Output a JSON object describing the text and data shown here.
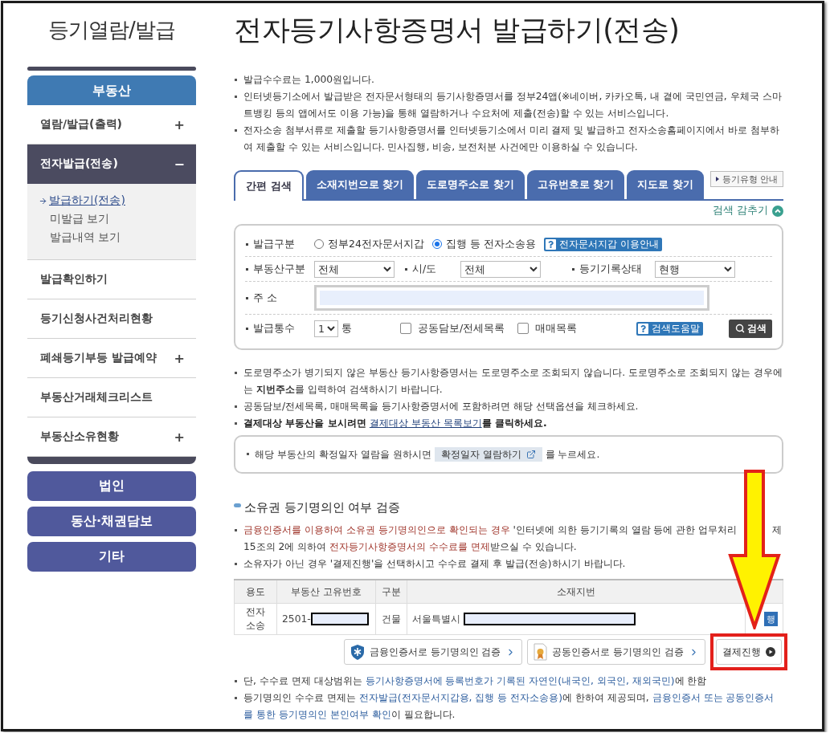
{
  "section_title": "등기열람/발급",
  "page_title": "전자등기사항증명서 발급하기(전송)",
  "sidebar": {
    "category": "부동산",
    "items": [
      {
        "label": "열람/발급(출력)",
        "toggle": "+",
        "selected": false
      },
      {
        "label": "전자발급(전송)",
        "toggle": "−",
        "selected": true,
        "children": [
          {
            "label": "발급하기(전송)",
            "selected": true
          },
          {
            "label": "미발급 보기",
            "selected": false
          },
          {
            "label": "발급내역 보기",
            "selected": false
          }
        ]
      },
      {
        "label": "발급확인하기",
        "selected": false
      },
      {
        "label": "등기신청사건처리현황",
        "selected": false
      },
      {
        "label": "폐쇄등기부등 발급예약",
        "toggle": "+",
        "selected": false
      },
      {
        "label": "부동산거래체크리스트",
        "selected": false
      },
      {
        "label": "부동산소유현황",
        "toggle": "+",
        "selected": false
      }
    ],
    "other_categories": [
      "법인",
      "동산·채권담보",
      "기타"
    ]
  },
  "intro_notes": [
    "발급수수료는 1,000원입니다.",
    "인터넷등기소에서 발급받은 전자문서형태의 등기사항증명서를 정부24앱(※네이버, 카카오톡, 내 곁에 국민연금, 우체국 스마트뱅킹 등의 앱에서도 이용 가능)을 통해 열람하거나 수요처에 제출(전송)할 수 있는 서비스입니다.",
    "전자소송 첨부서류로 제출할 등기사항증명서를 인터넷등기소에서 미리 결제 및 발급하고 전자소송홈페이지에서 바로 첨부하여 제출할 수 있는 서비스입니다. 민사집행, 비송, 보전처분 사건에만 이용하실 수 있습니다."
  ],
  "tabs": [
    {
      "label": "간편 검색",
      "selected": true
    },
    {
      "label": "소재지번으로 찾기",
      "selected": false
    },
    {
      "label": "도로명주소로 찾기",
      "selected": false
    },
    {
      "label": "고유번호로 찾기",
      "selected": false
    },
    {
      "label": "지도로 찾기",
      "selected": false
    }
  ],
  "guide_button": "등기유형 안내",
  "hide_search": "검색 감추기",
  "form": {
    "issue_type": {
      "label": "발급구분",
      "options": [
        {
          "label": "정부24전자문서지갑",
          "selected": false
        },
        {
          "label": "집행 등 전자소송용",
          "selected": true
        }
      ],
      "help": "전자문서지갑 이용안내"
    },
    "selects": [
      {
        "label": "부동산구분",
        "value": "전체"
      },
      {
        "label": "시/도",
        "value": "전체"
      },
      {
        "label": "등기기록상태",
        "value": "현행"
      }
    ],
    "address": {
      "label": "주 소"
    },
    "copies": {
      "label": "발급통수",
      "value": "1",
      "unit": "통"
    },
    "checkboxes": [
      {
        "label": "공동담보/전세목록",
        "checked": false
      },
      {
        "label": "매매목록",
        "checked": false
      }
    ],
    "help": "검색도움말",
    "search_button": "검색"
  },
  "search_notes": [
    {
      "text": "도로명주소가 병기되지 않은 부동산 등기사항증명서는 도로명주소로 조회되지 않습니다. 도로명주소로 조회되지 않는 경우에는 **지번주소**를 입력하여 검색하시기 바랍니다."
    },
    {
      "text": "공동담보/전세목록, 매매목록을 등기사항증명서에 포함하려면 해당 선택옵션을 체크하세요."
    },
    {
      "text": "결제대상 부동산을 보시려면 ",
      "link": "결제대상 부동산 목록보기",
      "suffix": "를 클릭하세요."
    }
  ],
  "info_box": {
    "prefix": "해당 부동산의 확정일자 열람을 원하시면",
    "button": "확정일자 열람하기",
    "suffix": "를 누르세요."
  },
  "verify": {
    "title": "소유권 등기명의인 여부 검증",
    "notes": [
      [
        {
          "text": "금융인증서를 이용하여 소유권 등기명의인으로 확인되는 경우",
          "emphasis": true
        },
        {
          "text": " '인터넷에 의한 등기기록의 열람 등에 관한 업무처리",
          "emphasis": false,
          "covered_after": true
        },
        {
          "text": "제 15조의 2에 의하여 ",
          "emphasis": false
        },
        {
          "text": "전자등기사항증명서의 수수료를 면제",
          "emphasis": true
        },
        {
          "text": "받으실 수 있습니다.",
          "emphasis": false
        }
      ],
      [
        {
          "text": "소유자가 아닌 경우 '결제진행'을 선택하시고 수수료 결제 후 발급(전송)하시기 바랍니다.",
          "emphasis": false
        }
      ]
    ],
    "table": {
      "columns": [
        "용도",
        "부동산 고유번호",
        "구분",
        "소재지번"
      ],
      "rows": [
        {
          "usage": "전자 소송",
          "unique_no": "2501-",
          "type": "건물",
          "address": "서울특별시",
          "action": "행"
        }
      ]
    },
    "buttons": [
      {
        "kind": "finance",
        "label": "금융인증서로 등기명의인 검증"
      },
      {
        "kind": "joint",
        "label": "공동인증서로 등기명의인 검증"
      },
      {
        "kind": "pay",
        "label": "결제진행"
      }
    ]
  },
  "footer_notes": [
    [
      {
        "text": "단, 수수료 면제 대상범위는 ",
        "emphasis": false
      },
      {
        "text": "등기사항증명서에 등록번호가 기록된 자연인(내국인, 외국인, 재외국민)",
        "emphasis": true
      },
      {
        "text": "에 한함",
        "emphasis": false
      }
    ],
    [
      {
        "text": "등기명의인 수수료 면제는 ",
        "emphasis": false
      },
      {
        "text": "전자발급(전자문서지갑용, 집행 등 전자소송용)",
        "emphasis": true
      },
      {
        "text": "에 한하여 제공되며, ",
        "emphasis": false
      },
      {
        "text": "금융인증서 또는 공동인증서를 통한 등기명의인 본인여부 확인",
        "emphasis": true
      },
      {
        "text": "이 필요합니다.",
        "emphasis": false
      }
    ]
  ]
}
